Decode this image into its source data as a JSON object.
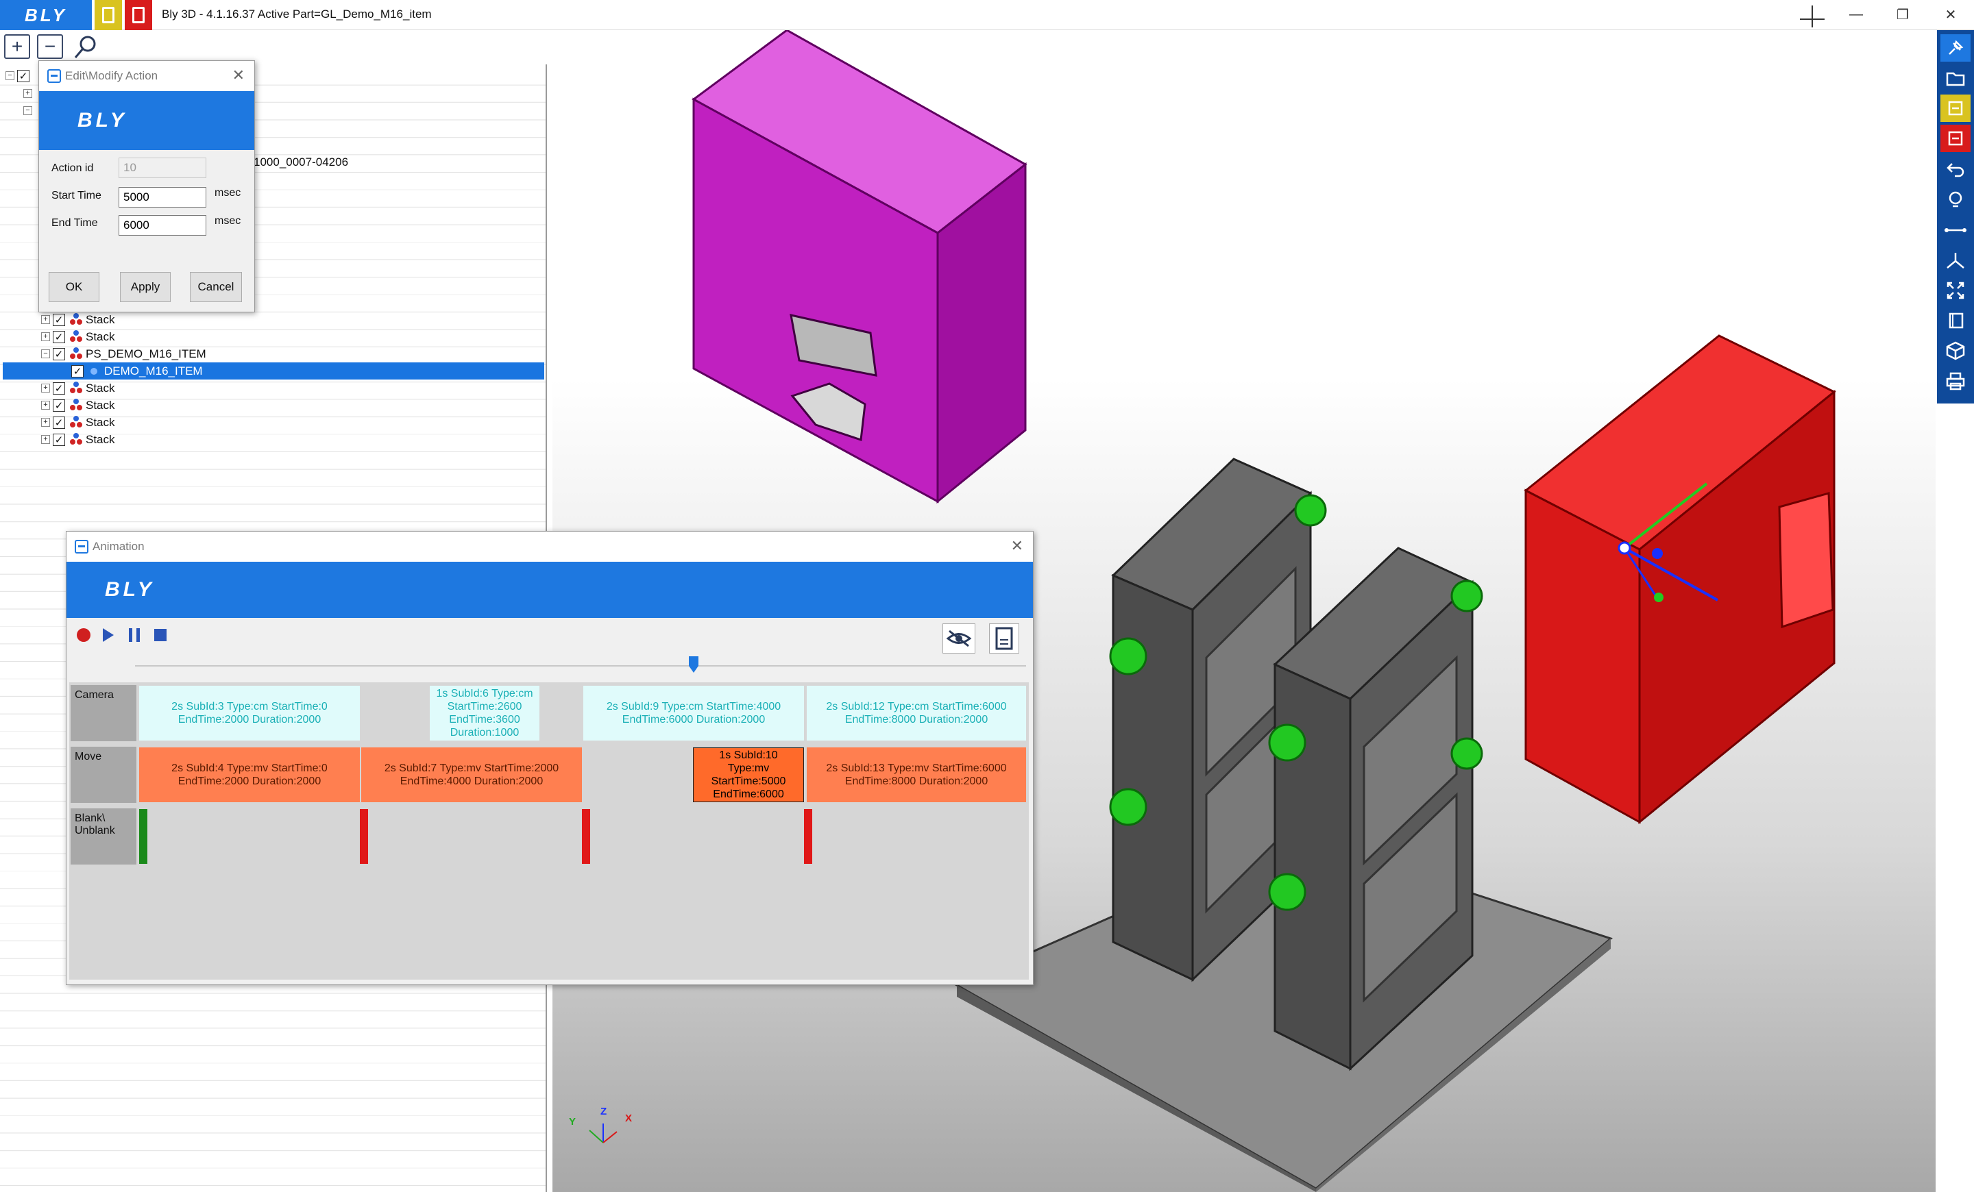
{
  "app": {
    "logo": "BLY",
    "title": "Bly 3D - 4.1.16.37 Active Part=GL_Demo_M16_item"
  },
  "window_controls": {
    "minimize": "—",
    "restore": "❐",
    "close": "✕"
  },
  "tree": {
    "partial_text": "1000_0007-04206",
    "rows": [
      {
        "label": "Stack",
        "icon": "stack-icon"
      },
      {
        "label": "Stack",
        "icon": "stack-icon"
      },
      {
        "label": "PS_DEMO_M16_ITEM",
        "icon": "stack-icon"
      },
      {
        "label": "DEMO_M16_ITEM",
        "icon": "part-icon",
        "selected": true
      },
      {
        "label": "Stack",
        "icon": "stack-icon"
      },
      {
        "label": "Stack",
        "icon": "stack-icon"
      },
      {
        "label": "Stack",
        "icon": "stack-icon"
      },
      {
        "label": "Stack",
        "icon": "stack-icon"
      }
    ]
  },
  "edit_dialog": {
    "title": "Edit\\Modify Action",
    "banner": "BLY",
    "action_id_label": "Action id",
    "action_id_value": "10",
    "start_label": "Start Time",
    "start_value": "5000",
    "end_label": "End Time",
    "end_value": "6000",
    "unit": "msec",
    "ok": "OK",
    "apply": "Apply",
    "cancel": "Cancel"
  },
  "animation": {
    "title": "Animation",
    "banner": "BLY",
    "slider_value_ms": 5000,
    "rows": {
      "camera": "Camera",
      "move": "Move",
      "blank_line1": "Blank\\",
      "blank_line2": "Unblank"
    },
    "camera_cells": [
      {
        "l1": "2s SubId:3 Type:cm StartTime:0",
        "l2": "EndTime:2000 Duration:2000"
      },
      {
        "l1": "1s SubId:6 Type:cm",
        "l2": "StartTime:2600",
        "l3": "EndTime:3600",
        "l4": "Duration:1000"
      },
      {
        "l1": "2s SubId:9 Type:cm StartTime:4000",
        "l2": "EndTime:6000 Duration:2000"
      },
      {
        "l1": "2s SubId:12 Type:cm StartTime:6000",
        "l2": "EndTime:8000 Duration:2000"
      }
    ],
    "move_cells": [
      {
        "l1": "2s SubId:4 Type:mv StartTime:0",
        "l2": "EndTime:2000 Duration:2000"
      },
      {
        "l1": "2s SubId:7 Type:mv StartTime:2000",
        "l2": "EndTime:4000 Duration:2000"
      },
      {
        "l1": "1s SubId:10",
        "l2": "Type:mv",
        "l3": "StartTime:5000",
        "l4": "EndTime:6000"
      },
      {
        "l1": "2s SubId:13 Type:mv StartTime:6000",
        "l2": "EndTime:8000 Duration:2000"
      }
    ]
  },
  "axes": {
    "z": "Z",
    "y": "Y",
    "x": "X"
  },
  "colors": {
    "brand_blue": "#1e78e0",
    "sidebar_blue": "#0f4a9a",
    "magenta_part": "#c020c0",
    "red_part": "#d81818",
    "fixture_green": "#22c822",
    "move_orange": "#ff7f50",
    "camera_cyan": "#e0fbfb"
  }
}
